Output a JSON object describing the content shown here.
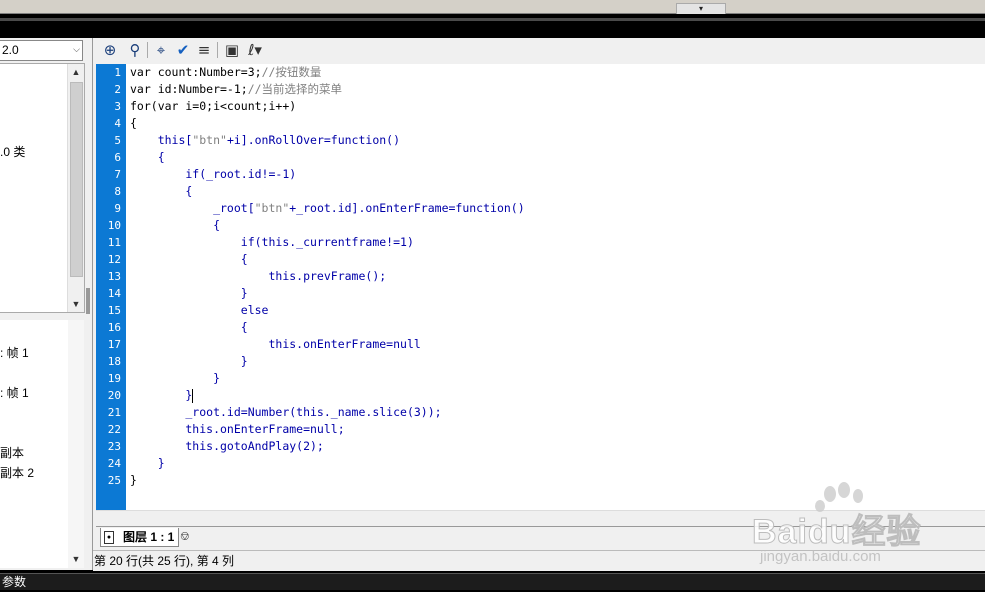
{
  "left_panel": {
    "version_value": "2.0",
    "tree_label": ".0 类",
    "list_items": [
      ": 帧 1",
      ": 帧 1",
      "副本",
      "副本 2"
    ]
  },
  "editor": {
    "lines": [
      [
        {
          "t": "var count:Number=3;",
          "c": ""
        },
        {
          "t": "//按钮数量",
          "c": "gray"
        }
      ],
      [
        {
          "t": "var id:Number=-1;",
          "c": ""
        },
        {
          "t": "//当前选择的菜单",
          "c": "gray"
        }
      ],
      [
        {
          "t": "for(var i=0;i<count;i++)",
          "c": ""
        }
      ],
      [
        {
          "t": "{",
          "c": ""
        }
      ],
      [
        {
          "t": "    this[",
          "c": "blue"
        },
        {
          "t": "\"btn\"",
          "c": "gray"
        },
        {
          "t": "+i].onRollOver=function()",
          "c": "blue"
        }
      ],
      [
        {
          "t": "    {",
          "c": "blue"
        }
      ],
      [
        {
          "t": "        if(_root.id!=-1)",
          "c": "blue"
        }
      ],
      [
        {
          "t": "        {",
          "c": "blue"
        }
      ],
      [
        {
          "t": "            _root[",
          "c": "blue"
        },
        {
          "t": "\"btn\"",
          "c": "gray"
        },
        {
          "t": "+_root.id].onEnterFrame=function()",
          "c": "blue"
        }
      ],
      [
        {
          "t": "            {",
          "c": "blue"
        }
      ],
      [
        {
          "t": "                if(this._currentframe!=1)",
          "c": "blue"
        }
      ],
      [
        {
          "t": "                {",
          "c": "blue"
        }
      ],
      [
        {
          "t": "                    this.prevFrame();",
          "c": "blue"
        }
      ],
      [
        {
          "t": "                }",
          "c": "blue"
        }
      ],
      [
        {
          "t": "                else",
          "c": "blue"
        }
      ],
      [
        {
          "t": "                {",
          "c": "blue"
        }
      ],
      [
        {
          "t": "                    this.onEnterFrame=null",
          "c": "blue"
        }
      ],
      [
        {
          "t": "                }",
          "c": "blue"
        }
      ],
      [
        {
          "t": "            }",
          "c": "blue"
        }
      ],
      [
        {
          "t": "        }",
          "c": "blue"
        }
      ],
      [
        {
          "t": "        _root.id=Number(this._name.slice(3));",
          "c": "blue"
        }
      ],
      [
        {
          "t": "        this.onEnterFrame=null;",
          "c": "blue"
        }
      ],
      [
        {
          "t": "        this.gotoAndPlay(2);",
          "c": "blue"
        }
      ],
      [
        {
          "t": "    }",
          "c": "blue"
        }
      ],
      [
        {
          "t": "}",
          "c": ""
        }
      ]
    ],
    "current_line": 20
  },
  "tab": {
    "label": "图层 1 : 1"
  },
  "status": {
    "text": "第 20 行(共 25 行), 第 4 列"
  },
  "bottom_panel": {
    "label": "参数"
  },
  "watermark": {
    "brand": "Baidu经验",
    "url": "jingyan.baidu.com"
  },
  "toolbar_icons": [
    "add-statement-icon",
    "find-icon",
    "target-path-icon",
    "check-syntax-icon",
    "auto-format-icon",
    "code-hint-icon",
    "debug-options-icon"
  ]
}
